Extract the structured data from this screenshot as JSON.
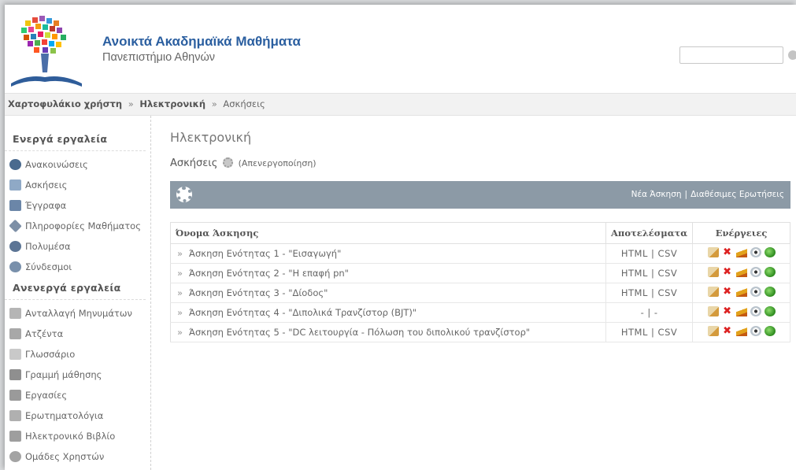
{
  "header": {
    "title": "Ανοικτά Ακαδημαϊκά Μαθήματα",
    "subtitle": "Πανεπιστήμιο Αθηνών"
  },
  "breadcrumb": {
    "items": [
      "Χαρτοφυλάκιο χρήστη",
      "Ηλεκτρονική",
      "Ασκήσεις"
    ],
    "separator": "»"
  },
  "sidebar": {
    "active_heading": "Ενεργά εργαλεία",
    "active_items": [
      {
        "label": "Ανακοινώσεις",
        "icon": "announcements-icon"
      },
      {
        "label": "Ασκήσεις",
        "icon": "exercises-icon"
      },
      {
        "label": "Έγγραφα",
        "icon": "documents-icon"
      },
      {
        "label": "Πληροφορίες Μαθήματος",
        "icon": "course-info-icon"
      },
      {
        "label": "Πολυμέσα",
        "icon": "multimedia-icon"
      },
      {
        "label": "Σύνδεσμοι",
        "icon": "links-icon"
      }
    ],
    "inactive_heading": "Ανενεργά εργαλεία",
    "inactive_items": [
      {
        "label": "Ανταλλαγή Μηνυμάτων",
        "icon": "messages-icon"
      },
      {
        "label": "Ατζέντα",
        "icon": "agenda-icon"
      },
      {
        "label": "Γλωσσάριο",
        "icon": "glossary-icon"
      },
      {
        "label": "Γραμμή μάθησης",
        "icon": "learning-path-icon"
      },
      {
        "label": "Εργασίες",
        "icon": "assignments-icon"
      },
      {
        "label": "Ερωτηματολόγια",
        "icon": "questionnaires-icon"
      },
      {
        "label": "Ηλεκτρονικό Βιβλίο",
        "icon": "ebook-icon"
      },
      {
        "label": "Ομάδες Χρηστών",
        "icon": "user-groups-icon"
      }
    ]
  },
  "main": {
    "course_title": "Ηλεκτρονική",
    "module_title": "Ασκήσεις",
    "module_status": "(Απενεργοποίηση)",
    "toolbar": {
      "new_exercise": "Νέα Άσκηση",
      "separator": "|",
      "available_questions": "Διαθέσιμες Ερωτήσεις"
    },
    "table": {
      "headers": [
        "Όνομα Άσκησης",
        "Αποτελέσματα",
        "Ενέργειες"
      ],
      "rows": [
        {
          "name": "Άσκηση Ενότητας 1 - \"Εισαγωγή\"",
          "results": "HTML | CSV"
        },
        {
          "name": "Άσκηση Ενότητας 2 - \"Η επαφή pn\"",
          "results": "HTML | CSV"
        },
        {
          "name": "Άσκηση Ενότητας 3 - \"Δίοδος\"",
          "results": "HTML | CSV"
        },
        {
          "name": "Άσκηση Ενότητας 4 - \"Διπολικά Τρανζίστορ (BJT)\"",
          "results": "-  |  -"
        },
        {
          "name": "Άσκηση Ενότητας 5 - \"DC λειτουργία - Πόλωση του διπολικού τρανζίστορ\"",
          "results": "HTML | CSV"
        }
      ],
      "row_bullet": "»",
      "action_icons": [
        "edit-icon",
        "delete-icon",
        "clean-icon",
        "view-icon",
        "export-icon"
      ]
    }
  },
  "colors": {
    "brand_blue": "#2b5fa0",
    "toolbar_bg": "#8c9aa6"
  }
}
